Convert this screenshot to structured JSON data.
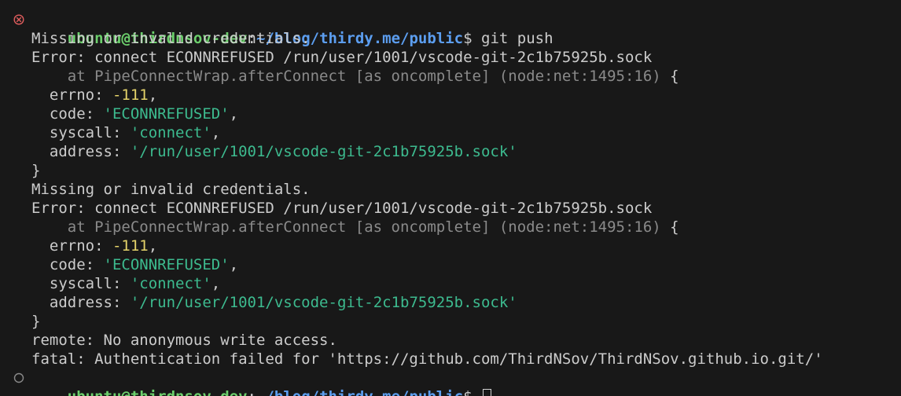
{
  "prompt1": {
    "user": "ubuntu@thirdnsov-dev",
    "sep": ":",
    "path": "~/blog/thirdy.me/public",
    "symbol": "$ ",
    "command": "git push",
    "status_icon": "error-circle-x-icon",
    "status_color": "#e05d5d"
  },
  "block1": {
    "missing": "Missing or invalid credentials.",
    "error": "Error: connect ECONNREFUSED /run/user/1001/vscode-git-2c1b75925b.sock",
    "at": "    at PipeConnectWrap.afterConnect [as oncomplete] (node:net:1495:16)",
    "brace_open": " {",
    "errno_key": "  errno: ",
    "errno_val": "-111",
    "code_key": "  code: ",
    "code_val": "'ECONNREFUSED'",
    "syscall_key": "  syscall: ",
    "syscall_val": "'connect'",
    "address_key": "  address: ",
    "address_val": "'/run/user/1001/vscode-git-2c1b75925b.sock'",
    "comma": ",",
    "brace_close": "}"
  },
  "block2": {
    "missing": "Missing or invalid credentials.",
    "error": "Error: connect ECONNREFUSED /run/user/1001/vscode-git-2c1b75925b.sock",
    "at": "    at PipeConnectWrap.afterConnect [as oncomplete] (node:net:1495:16)",
    "brace_open": " {",
    "errno_key": "  errno: ",
    "errno_val": "-111",
    "code_key": "  code: ",
    "code_val": "'ECONNREFUSED'",
    "syscall_key": "  syscall: ",
    "syscall_val": "'connect'",
    "address_key": "  address: ",
    "address_val": "'/run/user/1001/vscode-git-2c1b75925b.sock'",
    "comma": ",",
    "brace_close": "}"
  },
  "remote": "remote: No anonymous write access.",
  "fatal": "fatal: Authentication failed for 'https://github.com/ThirdNSov/ThirdNSov.github.io.git/'",
  "prompt2": {
    "user": "ubuntu@thirdnsov-dev",
    "sep": ":",
    "path": "~/blog/thirdy.me/public",
    "symbol": "$ ",
    "status_icon": "idle-circle-icon"
  }
}
